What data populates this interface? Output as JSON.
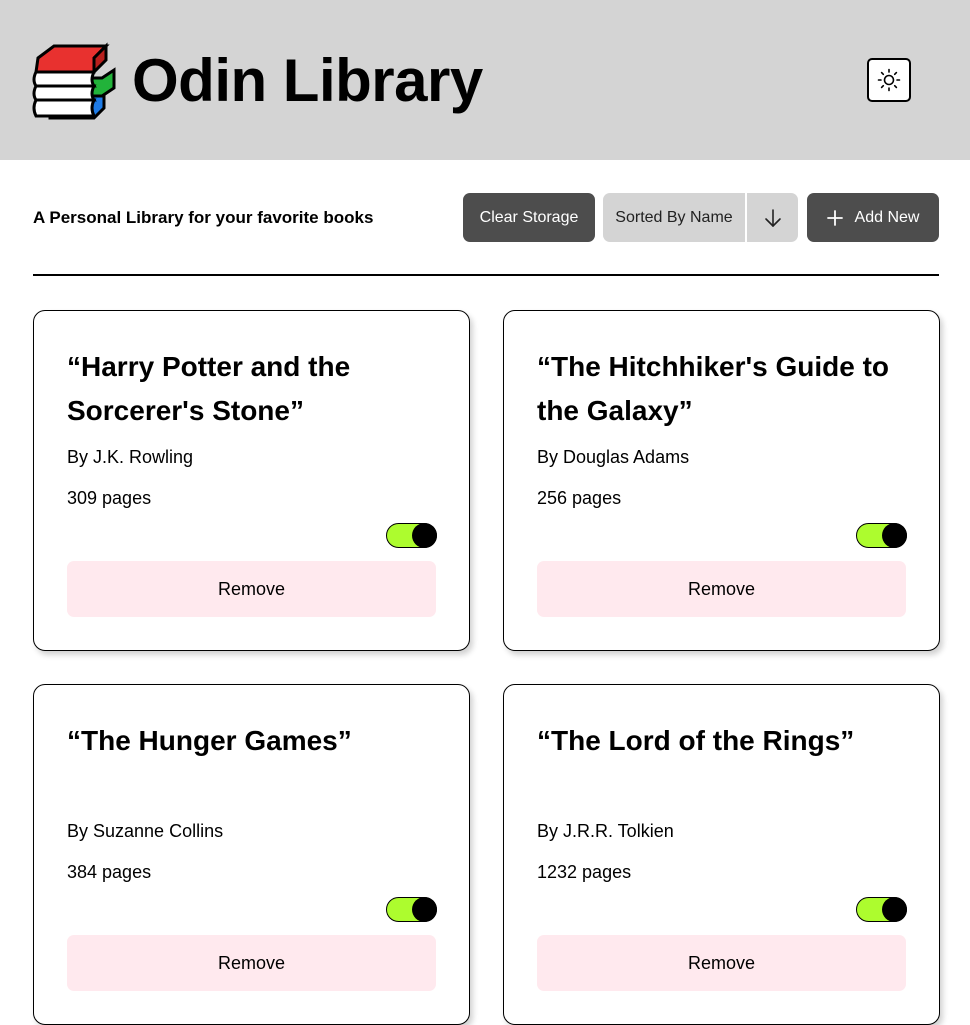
{
  "app": {
    "title": "Odin Library",
    "logo_icon": "books-stack-icon",
    "theme_toggle_icon": "sun-icon"
  },
  "toolbar": {
    "tagline": "A Personal Library for your favorite books",
    "clear_label": "Clear Storage",
    "sort_label": "Sorted By Name",
    "sort_direction_icon": "arrow-down-icon",
    "add_icon": "plus-icon",
    "add_label": "Add New"
  },
  "books": [
    {
      "title": "“Harry Potter and the Sorcerer's Stone”",
      "author": "By J.K. Rowling",
      "pages": "309 pages",
      "read": true,
      "remove_label": "Remove"
    },
    {
      "title": "“The Hitchhiker's Guide to the Galaxy”",
      "author": "By Douglas Adams",
      "pages": "256 pages",
      "read": true,
      "remove_label": "Remove"
    },
    {
      "title": "“The Hunger Games”",
      "author": "By Suzanne Collins",
      "pages": "384 pages",
      "read": true,
      "remove_label": "Remove"
    },
    {
      "title": "“The Lord of the Rings”",
      "author": "By J.R.R. Tolkien",
      "pages": "1232 pages",
      "read": true,
      "remove_label": "Remove"
    }
  ],
  "colors": {
    "header_bg": "#d4d4d4",
    "dark_button": "#4d4d4d",
    "toggle_on": "#adfc2e",
    "remove_bg": "#ffe9ee"
  }
}
